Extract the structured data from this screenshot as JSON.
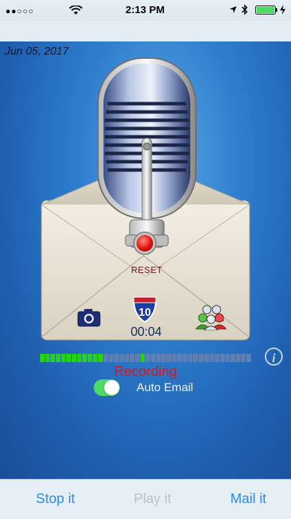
{
  "status_bar": {
    "signal": "●●○○○",
    "time": "2:13 PM",
    "battery_icon": "battery-icon"
  },
  "date": "Jun 05, 2017",
  "controls": {
    "reset_label": "RESET",
    "timer": "00:04",
    "highway_number": "10",
    "recording_label": "Recording",
    "auto_email_label": "Auto Email",
    "auto_email_on": true
  },
  "level_meter": {
    "total_segments": 40,
    "lit_segments": 12,
    "peak_segment": 19
  },
  "colors": {
    "accent": "#2a8ce6",
    "disabled": "#b8c2cc",
    "recording": "#e1131c",
    "toggle_on": "#4cd964",
    "meter_on": "#27d117",
    "meter_off": "#5f7fb4"
  },
  "tabs": {
    "stop_label": "Stop it",
    "play_label": "Play it",
    "mail_label": "Mail it"
  }
}
